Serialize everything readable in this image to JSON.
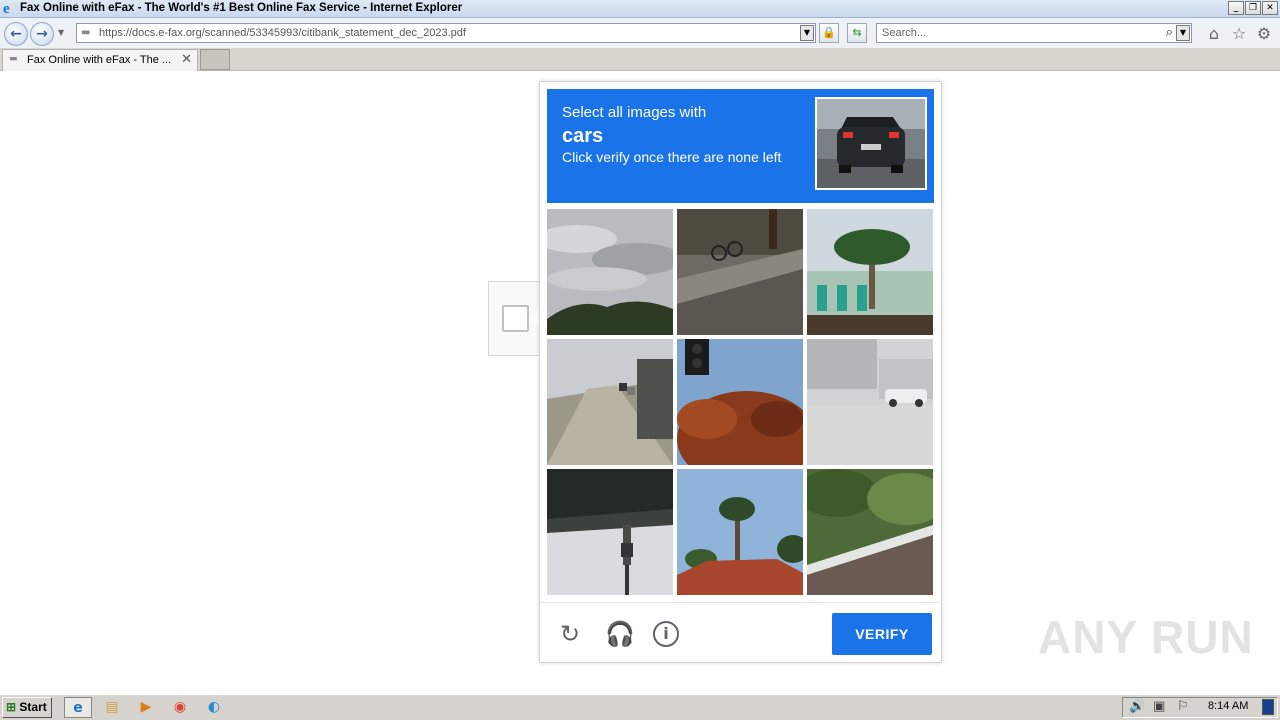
{
  "window": {
    "title": "Fax Online with eFax - The World's #1 Best Online Fax Service - Internet Explorer"
  },
  "address_bar": {
    "url": "https://docs.e-fax.org/scanned/53345993/citibank_statement_dec_2023.pdf"
  },
  "search": {
    "placeholder": "Search..."
  },
  "tabs": [
    {
      "label": "Fax Online with eFax - The ..."
    }
  ],
  "captcha": {
    "prompt_line1": "Select all images with",
    "prompt_target": "cars",
    "prompt_line3": "Click verify once there are none left",
    "tiles": [
      "cloudy sky with trees",
      "sidewalk with bicycle",
      "palm tree in front of building",
      "highway with cars",
      "traffic light with red tree",
      "parking lot with white car",
      "underside of bridge",
      "palm tree over red roof",
      "road with guardrail"
    ],
    "verify_label": "VERIFY",
    "icons": [
      "refresh-icon",
      "headphones-icon",
      "info-icon"
    ]
  },
  "watermark": "ANY RUN",
  "taskbar": {
    "start_label": "Start",
    "clock": "8:14 AM"
  },
  "colors": {
    "accent": "#1a73e8",
    "prompt_text": "#ffffff"
  }
}
